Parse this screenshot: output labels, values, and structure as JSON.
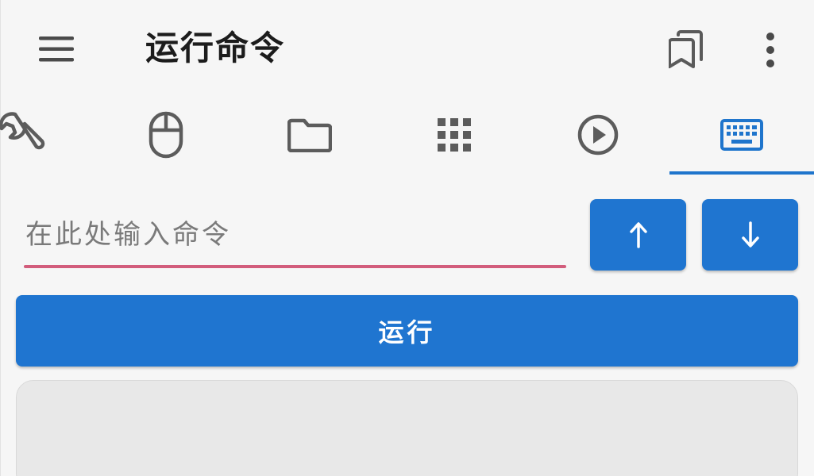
{
  "appbar": {
    "title": "运行命令",
    "menu_icon": "menu-icon",
    "bookmark_icon": "bookmarks-icon",
    "more_icon": "more-vertical-icon"
  },
  "tabs": [
    {
      "icon": "wrench-icon",
      "selected": false
    },
    {
      "icon": "mouse-icon",
      "selected": false
    },
    {
      "icon": "folder-icon",
      "selected": false
    },
    {
      "icon": "grid-icon",
      "selected": false
    },
    {
      "icon": "play-circle-icon",
      "selected": false
    },
    {
      "icon": "keyboard-icon",
      "selected": true
    }
  ],
  "command": {
    "placeholder": "在此处输入命令",
    "value": "",
    "history_up_label": "↑",
    "history_down_label": "↓",
    "run_label": "运行"
  },
  "colors": {
    "primary": "#1f75d0",
    "input_underline": "#d25d7c",
    "background": "#f6f6f6",
    "icon_gray": "#5c5c5c"
  }
}
